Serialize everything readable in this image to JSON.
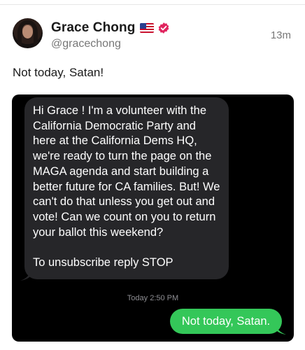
{
  "post": {
    "author": {
      "display_name": "Grace Chong",
      "handle": "@gracechong",
      "flag_icon": "us-flag-icon",
      "verified_icon": "verified-badge-icon",
      "verified_color": "#e0245e"
    },
    "time_ago": "13m",
    "text": "Not today, Satan!"
  },
  "message_screenshot": {
    "incoming": "Hi Grace ! I'm a volunteer with the California Democratic Party and here at the California Dems HQ, we're ready to turn the page on the MAGA agenda and start building a better future for CA families. But! We can't do that unless you get out and vote! Can we count on you to return your ballot this weekend?\n\nTo unsubscribe reply STOP",
    "timestamp_day": "Today",
    "timestamp_time": "2:50 PM",
    "outgoing": "Not today, Satan.",
    "colors": {
      "background": "#000000",
      "incoming_bubble": "#262629",
      "outgoing_bubble": "#34c759"
    }
  }
}
